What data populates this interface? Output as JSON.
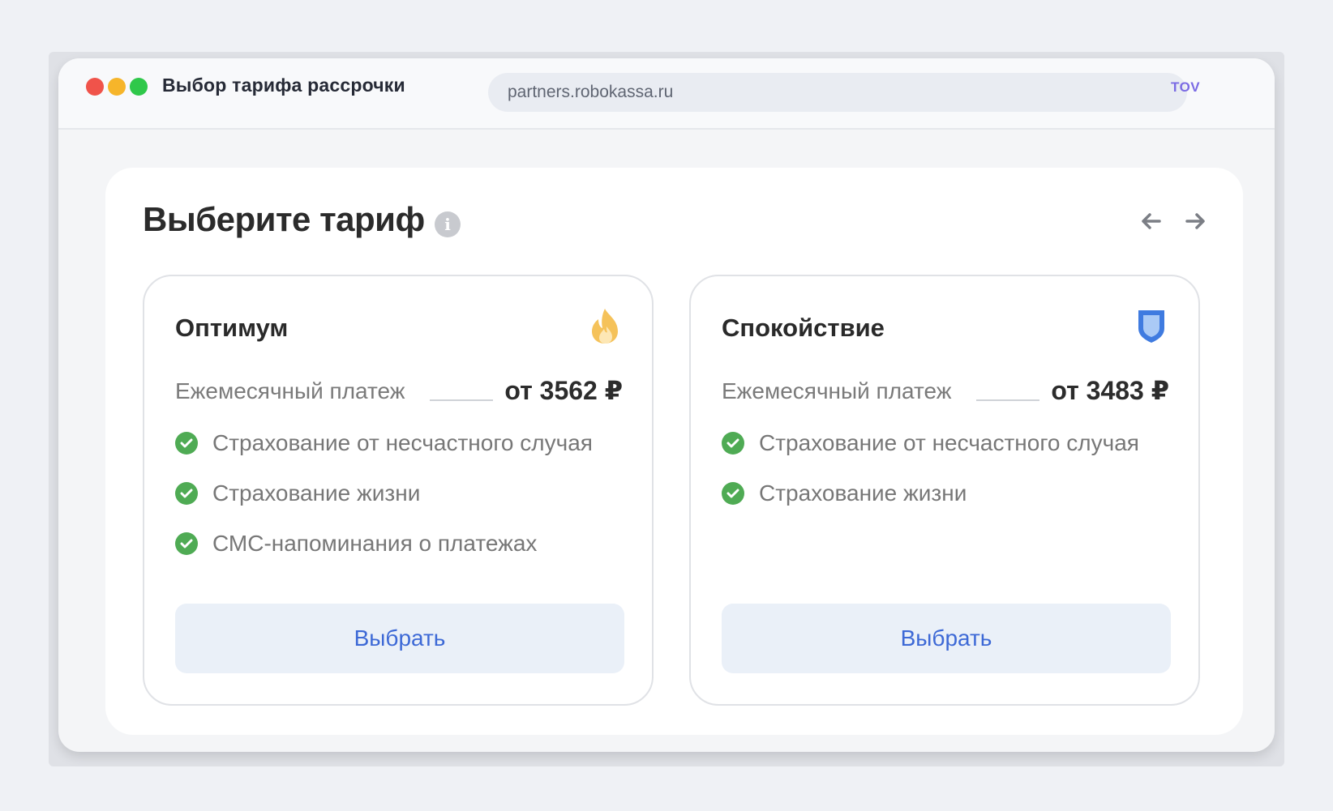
{
  "window": {
    "title": "Выбор тарифа рассрочки",
    "url": "partners.robokassa.ru",
    "url_badge": "TOV",
    "buttons": [
      "close",
      "minimize",
      "maximize"
    ]
  },
  "panel": {
    "title": "Выберите тариф",
    "info_icon": "info-icon",
    "nav": {
      "prev_icon": "arrow-left-icon",
      "next_icon": "arrow-right-icon"
    }
  },
  "tariffs": [
    {
      "name": "Оптимум",
      "icon": "flame-icon",
      "payment_label": "Ежемесячный платеж",
      "payment_value": "от 3562 ₽",
      "features": [
        "Страхование от несчастного случая",
        "Страхование жизни",
        "СМС-напоминания о платежах"
      ],
      "button_label": "Выбрать"
    },
    {
      "name": "Спокойствие",
      "icon": "shield-icon",
      "payment_label": "Ежемесячный платеж",
      "payment_value": "от 3483 ₽",
      "features": [
        "Страхование от несчастного случая",
        "Страхование жизни"
      ],
      "button_label": "Выбрать"
    }
  ],
  "colors": {
    "accent": "#3d69d6",
    "button_bg": "#eaf0f8",
    "check": "#4fab54",
    "flame": "#f5c25a",
    "shield": "#3f7be0"
  }
}
